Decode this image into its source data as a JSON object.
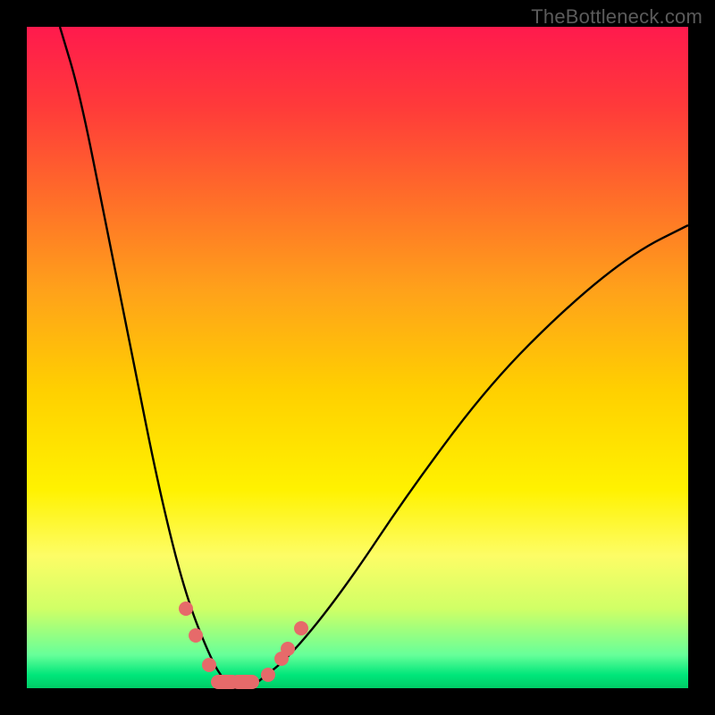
{
  "watermark": "TheBottleneck.com",
  "chart_data": {
    "type": "line",
    "title": "",
    "xlabel": "",
    "ylabel": "",
    "xlim": [
      0,
      100
    ],
    "ylim": [
      0,
      100
    ],
    "series": [
      {
        "name": "left-curve",
        "x": [
          5,
          8,
          12,
          16,
          20,
          24,
          28,
          30
        ],
        "values": [
          100,
          90,
          70,
          50,
          30,
          14,
          4,
          1
        ]
      },
      {
        "name": "right-curve",
        "x": [
          35,
          40,
          48,
          58,
          70,
          82,
          92,
          100
        ],
        "values": [
          1,
          5,
          15,
          30,
          46,
          58,
          66,
          70
        ]
      }
    ],
    "markers": [
      {
        "x": 24.0,
        "y": 12.0
      },
      {
        "x": 25.5,
        "y": 8.0
      },
      {
        "x": 27.5,
        "y": 3.5
      },
      {
        "x": 30.0,
        "y": 1.0,
        "wide": true
      },
      {
        "x": 33.0,
        "y": 1.0,
        "wide": true
      },
      {
        "x": 36.5,
        "y": 2.0
      },
      {
        "x": 38.5,
        "y": 4.5
      },
      {
        "x": 39.5,
        "y": 6.0
      },
      {
        "x": 41.5,
        "y": 9.0
      }
    ],
    "colors": {
      "curve": "#000000",
      "marker": "#e66a6a",
      "gradient_top": "#ff1a4d",
      "gradient_bottom": "#00cc66"
    }
  }
}
